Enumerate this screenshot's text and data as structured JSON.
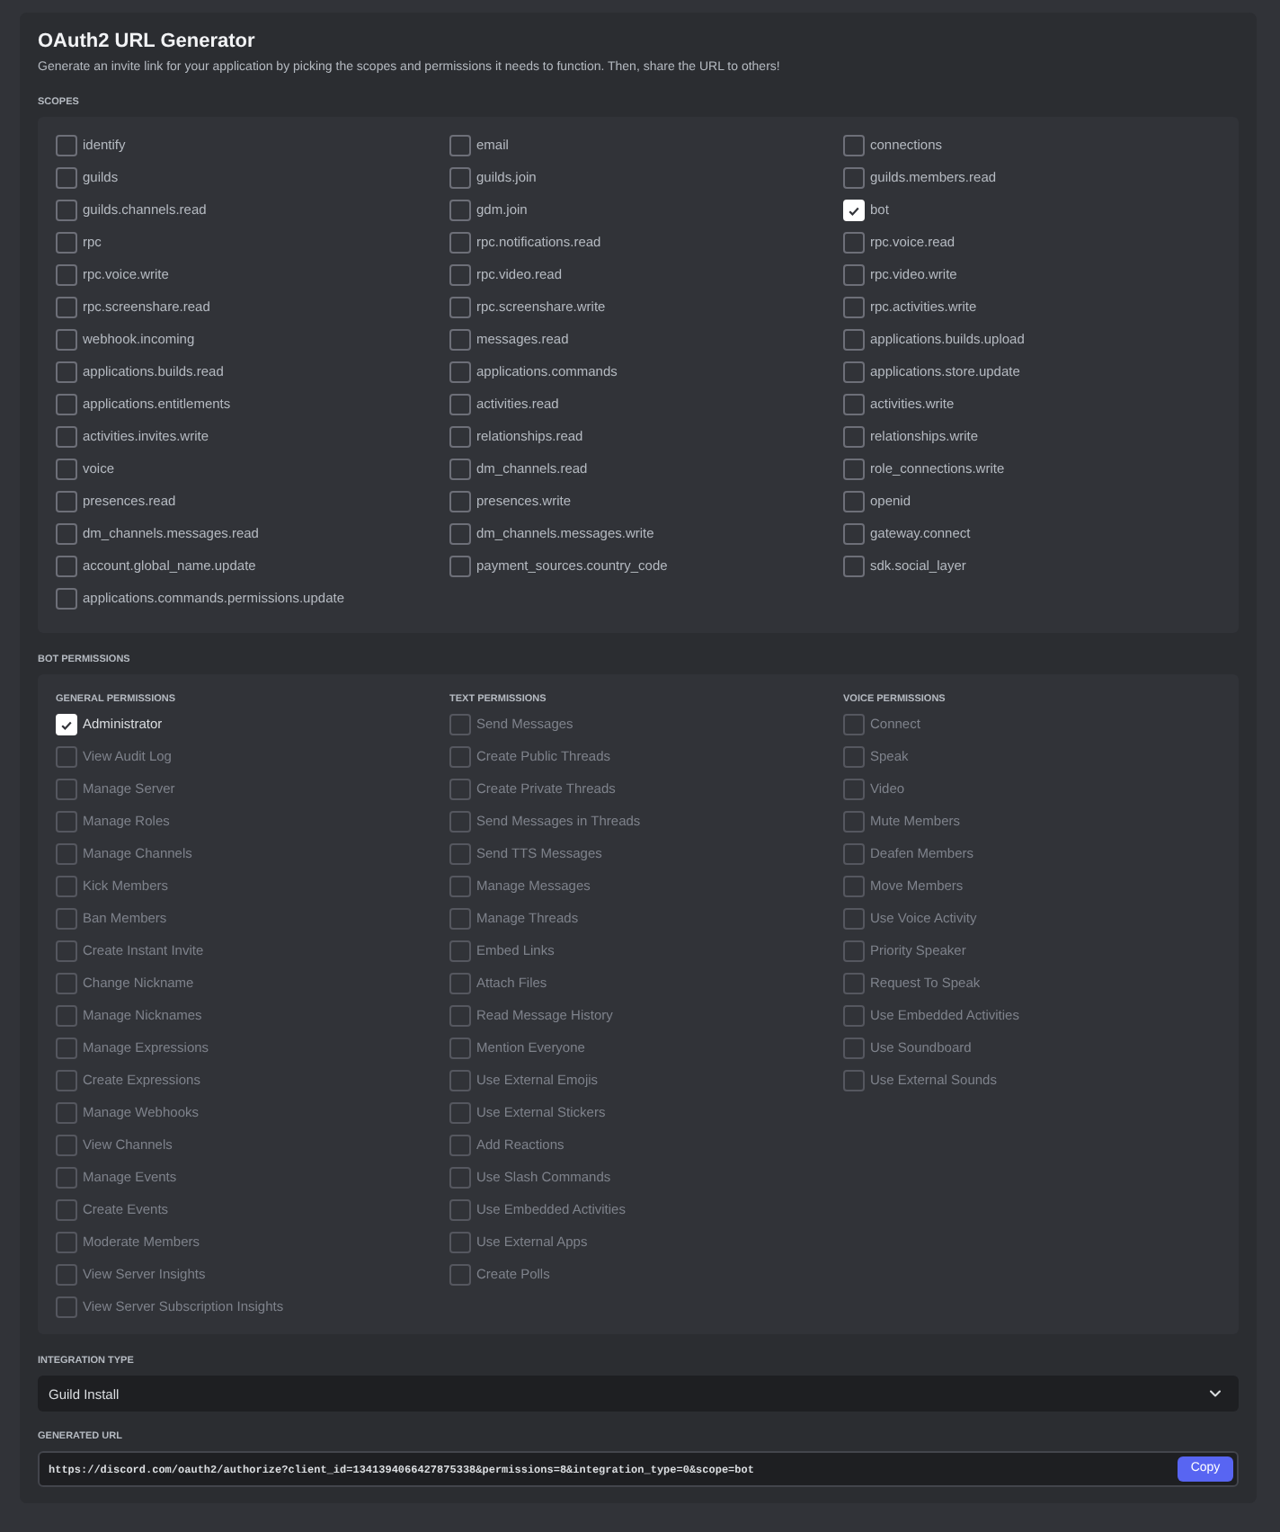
{
  "title": "OAuth2 URL Generator",
  "description": "Generate an invite link for your application by picking the scopes and permissions it needs to function. Then, share the URL to others!",
  "scopes": {
    "label": "SCOPES",
    "items": [
      {
        "label": "identify",
        "checked": false
      },
      {
        "label": "email",
        "checked": false
      },
      {
        "label": "connections",
        "checked": false
      },
      {
        "label": "guilds",
        "checked": false
      },
      {
        "label": "guilds.join",
        "checked": false
      },
      {
        "label": "guilds.members.read",
        "checked": false
      },
      {
        "label": "guilds.channels.read",
        "checked": false
      },
      {
        "label": "gdm.join",
        "checked": false
      },
      {
        "label": "bot",
        "checked": true
      },
      {
        "label": "rpc",
        "checked": false
      },
      {
        "label": "rpc.notifications.read",
        "checked": false
      },
      {
        "label": "rpc.voice.read",
        "checked": false
      },
      {
        "label": "rpc.voice.write",
        "checked": false
      },
      {
        "label": "rpc.video.read",
        "checked": false
      },
      {
        "label": "rpc.video.write",
        "checked": false
      },
      {
        "label": "rpc.screenshare.read",
        "checked": false
      },
      {
        "label": "rpc.screenshare.write",
        "checked": false
      },
      {
        "label": "rpc.activities.write",
        "checked": false
      },
      {
        "label": "webhook.incoming",
        "checked": false
      },
      {
        "label": "messages.read",
        "checked": false
      },
      {
        "label": "applications.builds.upload",
        "checked": false
      },
      {
        "label": "applications.builds.read",
        "checked": false
      },
      {
        "label": "applications.commands",
        "checked": false
      },
      {
        "label": "applications.store.update",
        "checked": false
      },
      {
        "label": "applications.entitlements",
        "checked": false
      },
      {
        "label": "activities.read",
        "checked": false
      },
      {
        "label": "activities.write",
        "checked": false
      },
      {
        "label": "activities.invites.write",
        "checked": false
      },
      {
        "label": "relationships.read",
        "checked": false
      },
      {
        "label": "relationships.write",
        "checked": false
      },
      {
        "label": "voice",
        "checked": false
      },
      {
        "label": "dm_channels.read",
        "checked": false
      },
      {
        "label": "role_connections.write",
        "checked": false
      },
      {
        "label": "presences.read",
        "checked": false
      },
      {
        "label": "presences.write",
        "checked": false
      },
      {
        "label": "openid",
        "checked": false
      },
      {
        "label": "dm_channels.messages.read",
        "checked": false
      },
      {
        "label": "dm_channels.messages.write",
        "checked": false
      },
      {
        "label": "gateway.connect",
        "checked": false
      },
      {
        "label": "account.global_name.update",
        "checked": false
      },
      {
        "label": "payment_sources.country_code",
        "checked": false
      },
      {
        "label": "sdk.social_layer",
        "checked": false
      },
      {
        "label": "applications.commands.permissions.update",
        "checked": false
      }
    ]
  },
  "bot_permissions": {
    "label": "BOT PERMISSIONS",
    "groups": [
      {
        "heading": "GENERAL PERMISSIONS",
        "items": [
          {
            "label": "Administrator",
            "checked": true,
            "disabled": false
          },
          {
            "label": "View Audit Log",
            "checked": false,
            "disabled": true
          },
          {
            "label": "Manage Server",
            "checked": false,
            "disabled": true
          },
          {
            "label": "Manage Roles",
            "checked": false,
            "disabled": true
          },
          {
            "label": "Manage Channels",
            "checked": false,
            "disabled": true
          },
          {
            "label": "Kick Members",
            "checked": false,
            "disabled": true
          },
          {
            "label": "Ban Members",
            "checked": false,
            "disabled": true
          },
          {
            "label": "Create Instant Invite",
            "checked": false,
            "disabled": true
          },
          {
            "label": "Change Nickname",
            "checked": false,
            "disabled": true
          },
          {
            "label": "Manage Nicknames",
            "checked": false,
            "disabled": true
          },
          {
            "label": "Manage Expressions",
            "checked": false,
            "disabled": true
          },
          {
            "label": "Create Expressions",
            "checked": false,
            "disabled": true
          },
          {
            "label": "Manage Webhooks",
            "checked": false,
            "disabled": true
          },
          {
            "label": "View Channels",
            "checked": false,
            "disabled": true
          },
          {
            "label": "Manage Events",
            "checked": false,
            "disabled": true
          },
          {
            "label": "Create Events",
            "checked": false,
            "disabled": true
          },
          {
            "label": "Moderate Members",
            "checked": false,
            "disabled": true
          },
          {
            "label": "View Server Insights",
            "checked": false,
            "disabled": true
          },
          {
            "label": "View Server Subscription Insights",
            "checked": false,
            "disabled": true
          }
        ]
      },
      {
        "heading": "TEXT PERMISSIONS",
        "items": [
          {
            "label": "Send Messages",
            "checked": false,
            "disabled": true
          },
          {
            "label": "Create Public Threads",
            "checked": false,
            "disabled": true
          },
          {
            "label": "Create Private Threads",
            "checked": false,
            "disabled": true
          },
          {
            "label": "Send Messages in Threads",
            "checked": false,
            "disabled": true
          },
          {
            "label": "Send TTS Messages",
            "checked": false,
            "disabled": true
          },
          {
            "label": "Manage Messages",
            "checked": false,
            "disabled": true
          },
          {
            "label": "Manage Threads",
            "checked": false,
            "disabled": true
          },
          {
            "label": "Embed Links",
            "checked": false,
            "disabled": true
          },
          {
            "label": "Attach Files",
            "checked": false,
            "disabled": true
          },
          {
            "label": "Read Message History",
            "checked": false,
            "disabled": true
          },
          {
            "label": "Mention Everyone",
            "checked": false,
            "disabled": true
          },
          {
            "label": "Use External Emojis",
            "checked": false,
            "disabled": true
          },
          {
            "label": "Use External Stickers",
            "checked": false,
            "disabled": true
          },
          {
            "label": "Add Reactions",
            "checked": false,
            "disabled": true
          },
          {
            "label": "Use Slash Commands",
            "checked": false,
            "disabled": true
          },
          {
            "label": "Use Embedded Activities",
            "checked": false,
            "disabled": true
          },
          {
            "label": "Use External Apps",
            "checked": false,
            "disabled": true
          },
          {
            "label": "Create Polls",
            "checked": false,
            "disabled": true
          }
        ]
      },
      {
        "heading": "VOICE PERMISSIONS",
        "items": [
          {
            "label": "Connect",
            "checked": false,
            "disabled": true
          },
          {
            "label": "Speak",
            "checked": false,
            "disabled": true
          },
          {
            "label": "Video",
            "checked": false,
            "disabled": true
          },
          {
            "label": "Mute Members",
            "checked": false,
            "disabled": true
          },
          {
            "label": "Deafen Members",
            "checked": false,
            "disabled": true
          },
          {
            "label": "Move Members",
            "checked": false,
            "disabled": true
          },
          {
            "label": "Use Voice Activity",
            "checked": false,
            "disabled": true
          },
          {
            "label": "Priority Speaker",
            "checked": false,
            "disabled": true
          },
          {
            "label": "Request To Speak",
            "checked": false,
            "disabled": true
          },
          {
            "label": "Use Embedded Activities",
            "checked": false,
            "disabled": true
          },
          {
            "label": "Use Soundboard",
            "checked": false,
            "disabled": true
          },
          {
            "label": "Use External Sounds",
            "checked": false,
            "disabled": true
          }
        ]
      }
    ]
  },
  "integration_type": {
    "label": "INTEGRATION TYPE",
    "value": "Guild Install"
  },
  "generated_url": {
    "label": "GENERATED URL",
    "value": "https://discord.com/oauth2/authorize?client_id=1341394066427875338&permissions=8&integration_type=0&scope=bot",
    "button": "Copy"
  }
}
